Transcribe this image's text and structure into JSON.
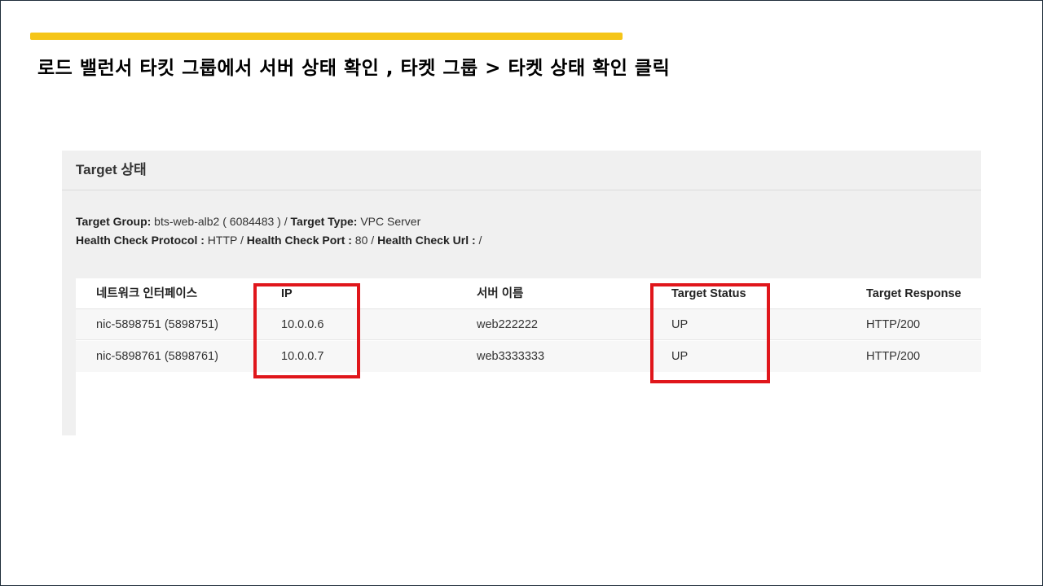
{
  "slide": {
    "title": "로드 밸런서 타킷 그룹에서 서버 상태 확인 , 타켓 그룹 > 타켓 상태 확인 클릭",
    "accent_color": "#f5c518",
    "highlight_color": "#e0161b"
  },
  "panel": {
    "header": "Target 상태",
    "target_group_label": "Target Group:",
    "target_group_value": " bts-web-alb2 ( 6084483 ) / ",
    "target_type_label": "Target Type:",
    "target_type_value": " VPC Server",
    "hc_protocol_label": "Health Check Protocol :",
    "hc_protocol_value": " HTTP / ",
    "hc_port_label": "Health Check Port :",
    "hc_port_value": " 80 / ",
    "hc_url_label": "Health Check Url :",
    "hc_url_value": " /"
  },
  "table": {
    "columns": [
      "네트워크 인터페이스",
      "IP",
      "서버 이름",
      "Target Status",
      "Target Response"
    ],
    "rows": [
      [
        "nic-5898751 (5898751)",
        "10.0.0.6",
        "web222222",
        "UP",
        "HTTP/200"
      ],
      [
        "nic-5898761 (5898761)",
        "10.0.0.7",
        "web3333333",
        "UP",
        "HTTP/200"
      ]
    ]
  }
}
